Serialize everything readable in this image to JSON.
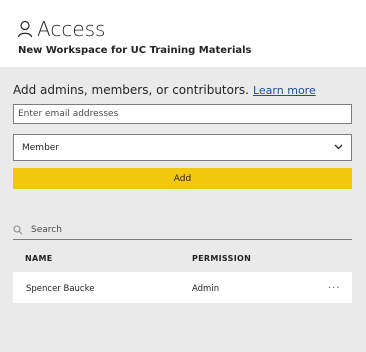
{
  "header": {
    "title": "Access",
    "subtitle": "New Workspace for UC Training Materials"
  },
  "form": {
    "intro_text": "Add admins, members, or contributors.",
    "learn_more": "Learn more",
    "email_placeholder": "Enter email addresses",
    "role_value": "Member",
    "add_label": "Add"
  },
  "search": {
    "placeholder": "Search"
  },
  "table": {
    "columns": [
      "NAME",
      "PERMISSION"
    ],
    "rows": [
      {
        "name": "Spencer Baucke",
        "permission": "Admin",
        "more": "..."
      }
    ]
  },
  "colors": {
    "accent": "#f2c80f",
    "link": "#1f4e97",
    "panel": "#eaeaea"
  },
  "icons": [
    "person-icon",
    "chevron-down-icon",
    "search-icon",
    "more-options-icon"
  ]
}
